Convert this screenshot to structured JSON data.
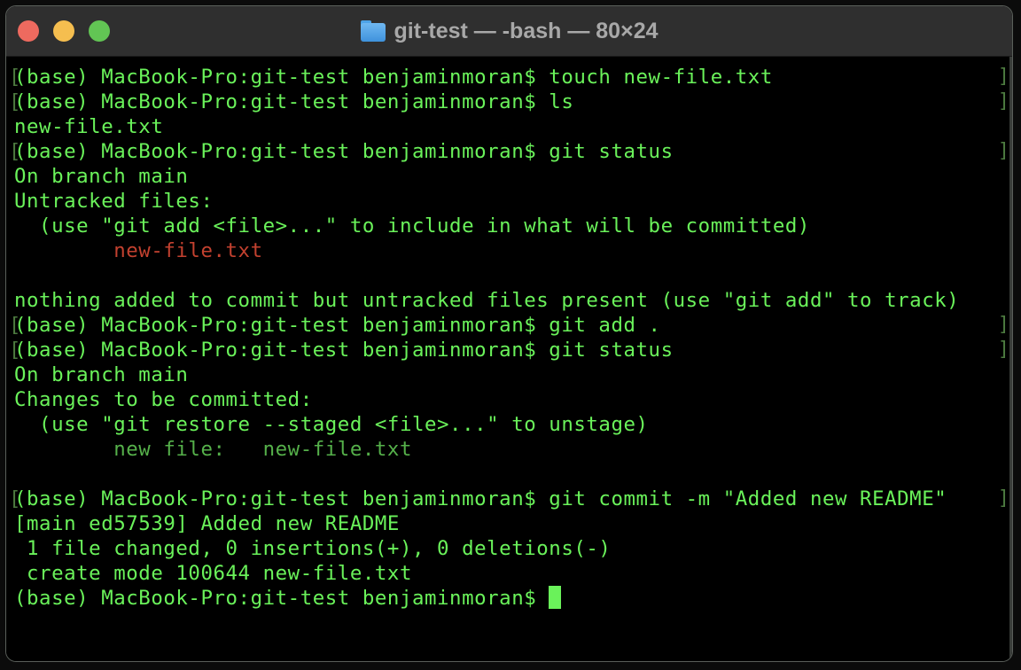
{
  "window": {
    "title": "git-test — -bash — 80×24",
    "folder_icon": "folder-icon"
  },
  "colors": {
    "prompt_green": "#6af25a",
    "untracked_red": "#c2412f",
    "staged_green": "#55b04a",
    "mark_green": "#4c7a3f",
    "background": "#000000",
    "titlebar": "#2f2f2f"
  },
  "terminal": {
    "lines": [
      {
        "mark": true,
        "segments": [
          {
            "text": "(base) MacBook-Pro:git-test benjaminmoran$ touch new-file.txt",
            "style": "normal"
          }
        ]
      },
      {
        "mark": true,
        "segments": [
          {
            "text": "(base) MacBook-Pro:git-test benjaminmoran$ ls",
            "style": "normal"
          }
        ]
      },
      {
        "mark": false,
        "segments": [
          {
            "text": "new-file.txt",
            "style": "normal"
          }
        ]
      },
      {
        "mark": true,
        "segments": [
          {
            "text": "(base) MacBook-Pro:git-test benjaminmoran$ git status",
            "style": "normal"
          }
        ]
      },
      {
        "mark": false,
        "segments": [
          {
            "text": "On branch main",
            "style": "normal"
          }
        ]
      },
      {
        "mark": false,
        "segments": [
          {
            "text": "Untracked files:",
            "style": "normal"
          }
        ]
      },
      {
        "mark": false,
        "segments": [
          {
            "text": "  (use \"git add <file>...\" to include in what will be committed)",
            "style": "normal"
          }
        ]
      },
      {
        "mark": false,
        "segments": [
          {
            "text": "        ",
            "style": "normal"
          },
          {
            "text": "new-file.txt",
            "style": "red"
          }
        ]
      },
      {
        "mark": false,
        "segments": [
          {
            "text": "",
            "style": "normal"
          }
        ]
      },
      {
        "mark": false,
        "segments": [
          {
            "text": "nothing added to commit but untracked files present (use \"git add\" to track)",
            "style": "normal"
          }
        ]
      },
      {
        "mark": true,
        "segments": [
          {
            "text": "(base) MacBook-Pro:git-test benjaminmoran$ git add .",
            "style": "normal"
          }
        ]
      },
      {
        "mark": true,
        "segments": [
          {
            "text": "(base) MacBook-Pro:git-test benjaminmoran$ git status",
            "style": "normal"
          }
        ]
      },
      {
        "mark": false,
        "segments": [
          {
            "text": "On branch main",
            "style": "normal"
          }
        ]
      },
      {
        "mark": false,
        "segments": [
          {
            "text": "Changes to be committed:",
            "style": "normal"
          }
        ]
      },
      {
        "mark": false,
        "segments": [
          {
            "text": "  (use \"git restore --staged <file>...\" to unstage)",
            "style": "normal"
          }
        ]
      },
      {
        "mark": false,
        "segments": [
          {
            "text": "        ",
            "style": "normal"
          },
          {
            "text": "new file:   new-file.txt",
            "style": "dim"
          }
        ]
      },
      {
        "mark": false,
        "segments": [
          {
            "text": "",
            "style": "normal"
          }
        ]
      },
      {
        "mark": true,
        "segments": [
          {
            "text": "(base) MacBook-Pro:git-test benjaminmoran$ git commit -m \"Added new README\"",
            "style": "normal"
          }
        ]
      },
      {
        "mark": false,
        "segments": [
          {
            "text": "[main ed57539] Added new README",
            "style": "normal"
          }
        ]
      },
      {
        "mark": false,
        "segments": [
          {
            "text": " 1 file changed, 0 insertions(+), 0 deletions(-)",
            "style": "normal"
          }
        ]
      },
      {
        "mark": false,
        "segments": [
          {
            "text": " create mode 100644 new-file.txt",
            "style": "normal"
          }
        ]
      },
      {
        "mark": false,
        "cursor": true,
        "segments": [
          {
            "text": "(base) MacBook-Pro:git-test benjaminmoran$ ",
            "style": "normal"
          }
        ]
      }
    ]
  }
}
